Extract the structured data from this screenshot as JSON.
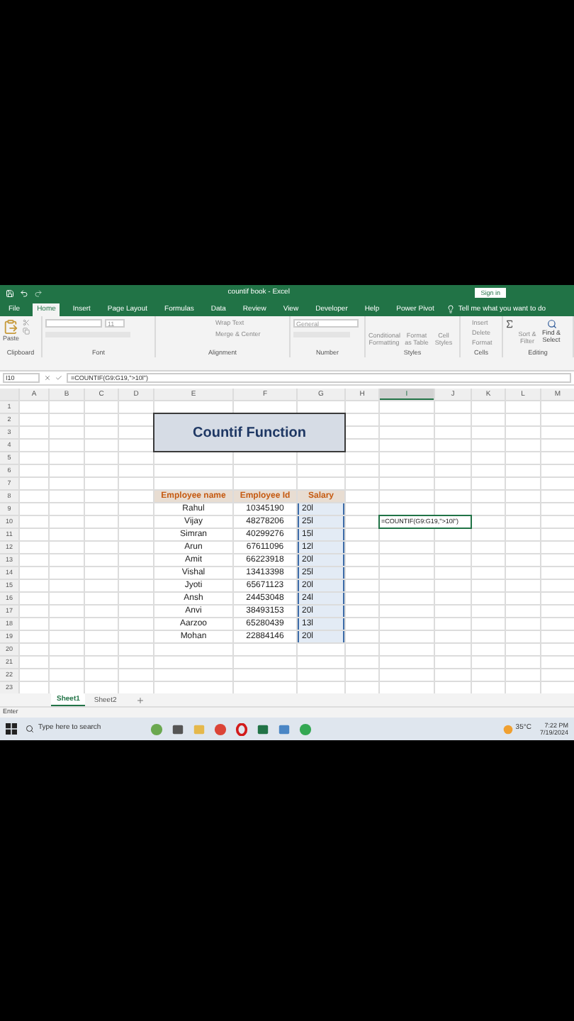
{
  "title_bar": {
    "title": "countif book - Excel",
    "sign_in": "Sign in"
  },
  "ribbon_tabs": [
    {
      "label": "File",
      "selected": false
    },
    {
      "label": "Home",
      "selected": true
    },
    {
      "label": "Insert",
      "selected": false
    },
    {
      "label": "Page Layout",
      "selected": false
    },
    {
      "label": "Formulas",
      "selected": false
    },
    {
      "label": "Data",
      "selected": false
    },
    {
      "label": "Review",
      "selected": false
    },
    {
      "label": "View",
      "selected": false
    },
    {
      "label": "Developer",
      "selected": false
    },
    {
      "label": "Help",
      "selected": false
    },
    {
      "label": "Power Pivot",
      "selected": false
    }
  ],
  "tell_me": "Tell me what you want to do",
  "ribbon": {
    "paste": "Paste",
    "font_size": "11",
    "wrap_text": "Wrap Text",
    "merge_center": "Merge & Center",
    "number_format": "General",
    "conditional_formatting": "Conditional Formatting",
    "format_as_table": "Format as Table",
    "cell_styles": "Cell Styles",
    "insert": "Insert",
    "delete": "Delete",
    "format": "Format",
    "sort_filter": "Sort & Filter",
    "find_select": "Find & Select",
    "groups": [
      "Clipboard",
      "Font",
      "Alignment",
      "Number",
      "Styles",
      "Cells",
      "Editing"
    ]
  },
  "formula_bar": {
    "name_box": "I10",
    "formula": "=COUNTIF(G9:G19,\">10l\")"
  },
  "columns": [
    {
      "label": "A",
      "selected": false
    },
    {
      "label": "B",
      "selected": false
    },
    {
      "label": "C",
      "selected": false
    },
    {
      "label": "D",
      "selected": false
    },
    {
      "label": "E",
      "selected": false
    },
    {
      "label": "F",
      "selected": false
    },
    {
      "label": "G",
      "selected": false
    },
    {
      "label": "H",
      "selected": false
    },
    {
      "label": "I",
      "selected": true
    },
    {
      "label": "J",
      "selected": false
    },
    {
      "label": "K",
      "selected": false
    },
    {
      "label": "L",
      "selected": false
    },
    {
      "label": "M",
      "selected": false
    }
  ],
  "row_numbers": [
    "1",
    "2",
    "3",
    "4",
    "5",
    "6",
    "7",
    "8",
    "9",
    "10",
    "11",
    "12",
    "13",
    "14",
    "15",
    "16",
    "17",
    "18",
    "19",
    "20",
    "21",
    "22",
    "23"
  ],
  "title_cell": "Countif Function",
  "table": {
    "columns": [
      "Employee name",
      "Employee Id",
      "Salary"
    ],
    "salary_highlighted": true,
    "rows": [
      [
        "Rahul",
        "10345190",
        "20l"
      ],
      [
        "Vijay",
        "48278206",
        "25l"
      ],
      [
        "Simran",
        "40299276",
        "15l"
      ],
      [
        "Arun",
        "67611096",
        "12l"
      ],
      [
        "Amit",
        "66223918",
        "20l"
      ],
      [
        "Vishal",
        "13413398",
        "25l"
      ],
      [
        "Jyoti",
        "65671123",
        "20l"
      ],
      [
        "Ansh",
        "24453048",
        "24l"
      ],
      [
        "Anvi",
        "38493153",
        "20l"
      ],
      [
        "Aarzoo",
        "65280439",
        "13l"
      ],
      [
        "Mohan",
        "22884146",
        "20l"
      ]
    ]
  },
  "active_cell_text": "=COUNTIF(G9:G19,\">10l\")",
  "sheet_tabs": [
    {
      "label": "Sheet1",
      "selected": true
    },
    {
      "label": "Sheet2",
      "selected": false
    }
  ],
  "status": "Enter",
  "taskbar": {
    "search_placeholder": "Type here to search",
    "temperature": "35°C",
    "time": "7:22 PM",
    "date": "7/19/2024"
  }
}
